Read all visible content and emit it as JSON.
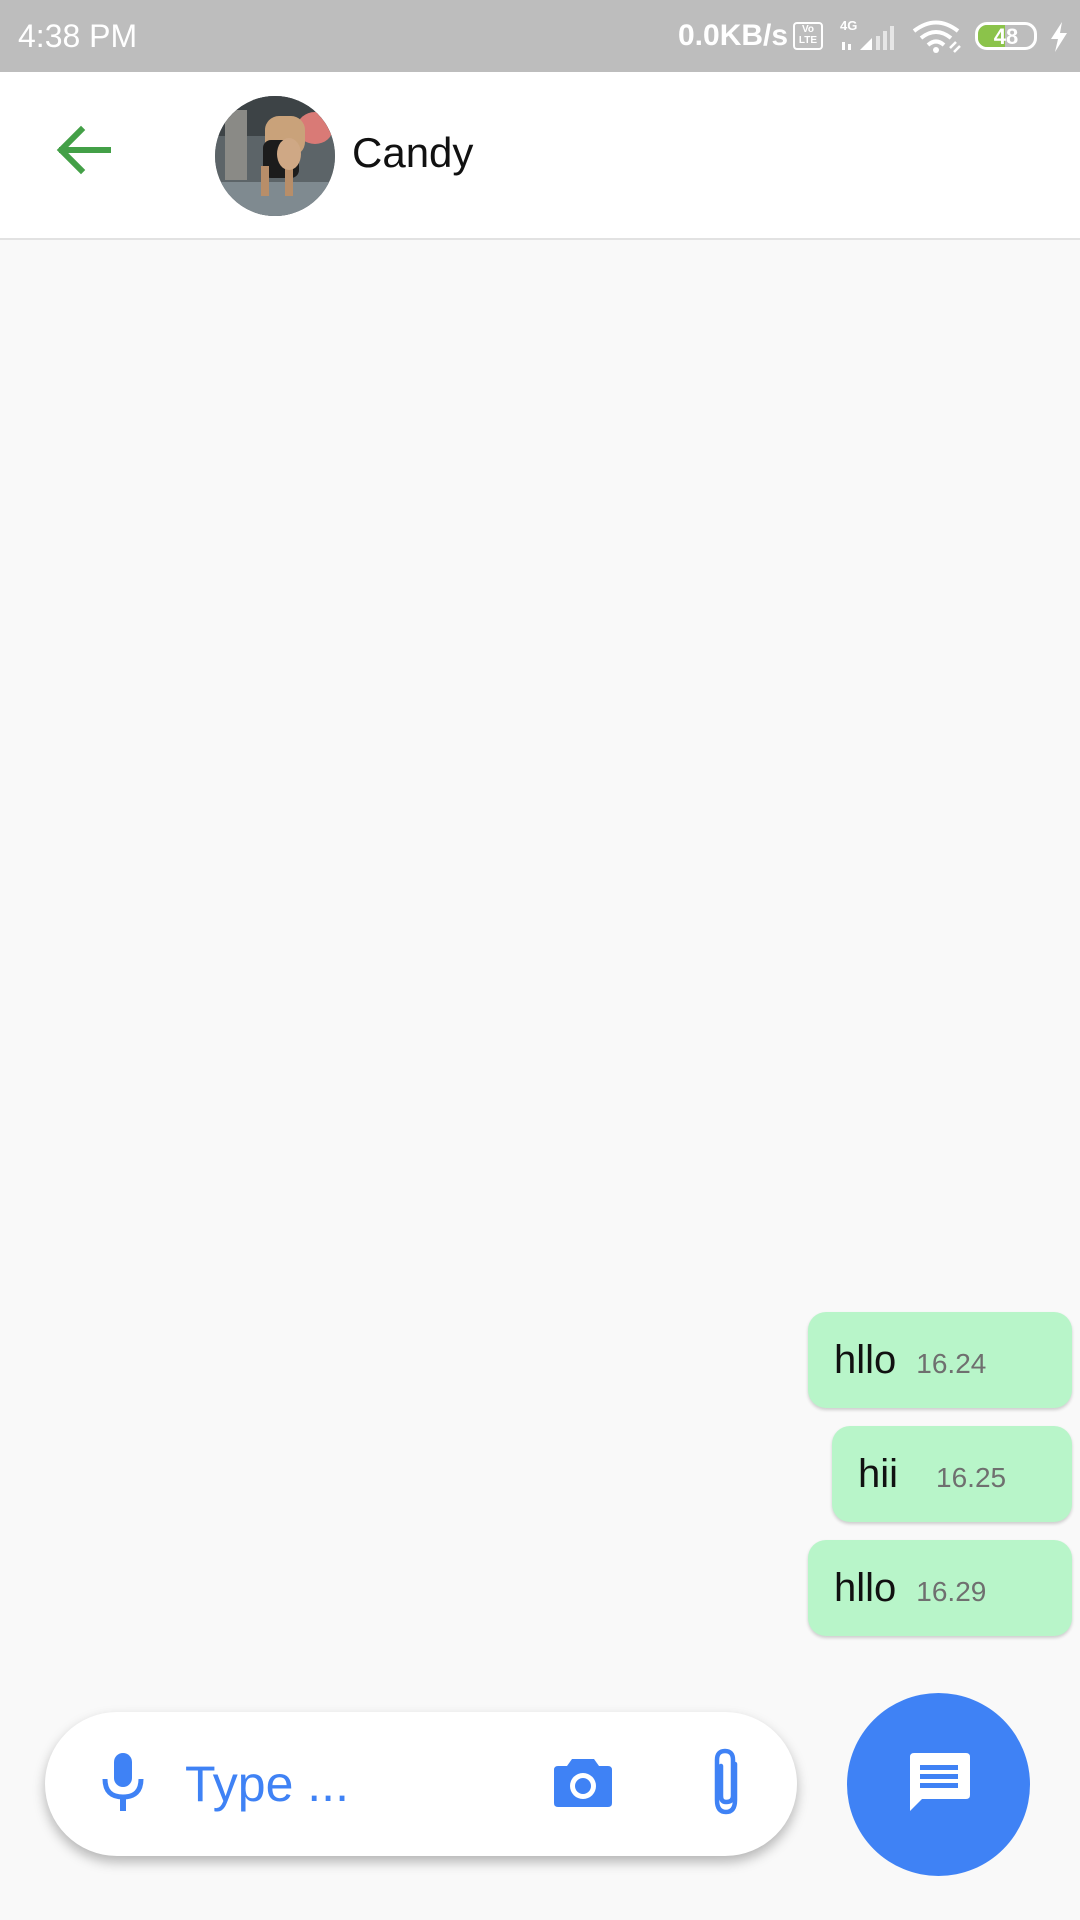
{
  "status_bar": {
    "time": "4:38 PM",
    "network_speed": "0.0KB/s",
    "volte": "Vo LTE",
    "network_type": "4G",
    "battery_level": "48",
    "battery_fraction": 0.48
  },
  "header": {
    "contact_name": "Candy",
    "back_icon": "arrow-left-icon",
    "avatar_alt": "Candy"
  },
  "messages": [
    {
      "text": "hllo",
      "time": "16.24"
    },
    {
      "text": "hii",
      "time": "16.25"
    },
    {
      "text": "hllo",
      "time": "16.29"
    }
  ],
  "composer": {
    "placeholder": "Type ...",
    "mic_icon": "microphone-icon",
    "camera_icon": "camera-icon",
    "attach_icon": "paperclip-icon",
    "send_icon": "message-icon"
  },
  "colors": {
    "accent_green": "#43a047",
    "accent_blue": "#3f82f5",
    "bubble_bg": "#b8f5c9",
    "status_bar_bg": "#bdbdbd"
  }
}
